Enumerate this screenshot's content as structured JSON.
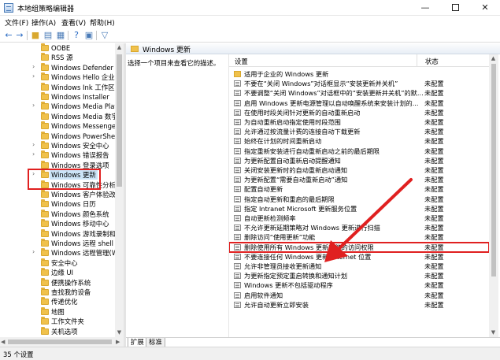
{
  "window": {
    "title": "本地组策略编辑器",
    "minimize_glyph": "—",
    "close_glyph": "✕"
  },
  "menu": [
    "文件(F)",
    "操作(A)",
    "查看(V)",
    "帮助(H)"
  ],
  "toolbar": {
    "icons": [
      "back-arrow-icon",
      "forward-arrow-icon",
      "folder-up-icon",
      "show-tree-icon",
      "properties-icon",
      "help-icon",
      "show-hide-icon",
      "filter-icon"
    ]
  },
  "tree": {
    "items": [
      {
        "label": "OOBE",
        "chevron": false
      },
      {
        "label": "RSS 源",
        "chevron": false
      },
      {
        "label": "Windows Defender Sm",
        "chevron": true
      },
      {
        "label": "Windows Hello 企业版",
        "chevron": true
      },
      {
        "label": "Windows Ink 工作区",
        "chevron": false
      },
      {
        "label": "Windows Installer",
        "chevron": false
      },
      {
        "label": "Windows Media Playe",
        "chevron": true
      },
      {
        "label": "Windows Media 数字",
        "chevron": false
      },
      {
        "label": "Windows Messenger",
        "chevron": false
      },
      {
        "label": "Windows PowerShell",
        "chevron": false
      },
      {
        "label": "Windows 安全中心",
        "chevron": true
      },
      {
        "label": "Windows 错误报告",
        "chevron": true
      },
      {
        "label": "Windows 登录选项",
        "chevron": false
      },
      {
        "label": "Windows 更新",
        "chevron": true,
        "selected": true
      },
      {
        "label": "Windows 可靠性分析",
        "chevron": false
      },
      {
        "label": "Windows 客户体验改善",
        "chevron": false
      },
      {
        "label": "Windows 日历",
        "chevron": false
      },
      {
        "label": "Windows 颜色系统",
        "chevron": false
      },
      {
        "label": "Windows 移动中心",
        "chevron": false
      },
      {
        "label": "Windows 游戏录制和广",
        "chevron": false
      },
      {
        "label": "Windows 远程 shell",
        "chevron": false
      },
      {
        "label": "Windows 远程管理(Wi",
        "chevron": true
      },
      {
        "label": "安全中心",
        "chevron": false
      },
      {
        "label": "边缘 UI",
        "chevron": false
      },
      {
        "label": "便携操作系统",
        "chevron": false
      },
      {
        "label": "查找我的设备",
        "chevron": false
      },
      {
        "label": "传递优化",
        "chevron": false
      },
      {
        "label": "地图",
        "chevron": false
      },
      {
        "label": "工作文件夹",
        "chevron": false
      },
      {
        "label": "关机选项",
        "chevron": false
      }
    ]
  },
  "right": {
    "header": "Windows 更新",
    "description": "选择一个项目来查看它的描述。",
    "col_setting": "设置",
    "col_state": "状态",
    "rows": [
      {
        "name": "适用于企业的 Windows 更新",
        "state": "",
        "folder": true
      },
      {
        "name": "不要在“关闭 Windows”对话框显示“安装更新并关机”",
        "state": "未配置"
      },
      {
        "name": "不要调整“关闭 Windows”对话框中的“安装更新并关机”的默...",
        "state": "未配置"
      },
      {
        "name": "启用 Windows 更新电源管理以自动唤醒系统来安装计划的...",
        "state": "未配置"
      },
      {
        "name": "在使用时段关闭针对更新的自动重新启动",
        "state": "未配置"
      },
      {
        "name": "为自动重新启动指定使用时段范围",
        "state": "未配置"
      },
      {
        "name": "允许通过按流量计费的连接自动下载更新",
        "state": "未配置"
      },
      {
        "name": "始终在计划的时间重新启动",
        "state": "未配置"
      },
      {
        "name": "指定重新安装进行自动重新启动之前的最后期限",
        "state": "未配置"
      },
      {
        "name": "为更新配置自动重新启动提醒通知",
        "state": "未配置"
      },
      {
        "name": "关闭安装更新时的自动重新启动通知",
        "state": "未配置"
      },
      {
        "name": "为更新配置“需要自动重新启动”通知",
        "state": "未配置"
      },
      {
        "name": "配置自动更新",
        "state": "未配置"
      },
      {
        "name": "指定自动更新和重启的最后期限",
        "state": "未配置"
      },
      {
        "name": "指定 Intranet Microsoft 更新服务位置",
        "state": "未配置"
      },
      {
        "name": "自动更新检测频率",
        "state": "未配置"
      },
      {
        "name": "不允许更新延期策略对 Windows 更新进行扫描",
        "state": "未配置"
      },
      {
        "name": "删除访问“使用更新”功能",
        "state": "未配置"
      },
      {
        "name": "删除使用所有 Windows 更新功能的访问权限",
        "state": "未配置",
        "highlight": true
      },
      {
        "name": "不要连接任何 Windows 更新 Internet 位置",
        "state": "未配置"
      },
      {
        "name": "允许非管理员接收更新通知",
        "state": "未配置"
      },
      {
        "name": "为更新指定预定重启转换和通知计划",
        "state": "未配置"
      },
      {
        "name": "Windows 更新不包括驱动程序",
        "state": "未配置"
      },
      {
        "name": "启用软件通知",
        "state": "未配置"
      },
      {
        "name": "允许自动更新立即安装",
        "state": "未配置"
      }
    ]
  },
  "tabs": [
    "扩展",
    "标准"
  ],
  "status": "35 个设置",
  "colors": {
    "annotation_red": "#e02020",
    "selection": "#cce4f7",
    "folder": "#f0c14b"
  }
}
